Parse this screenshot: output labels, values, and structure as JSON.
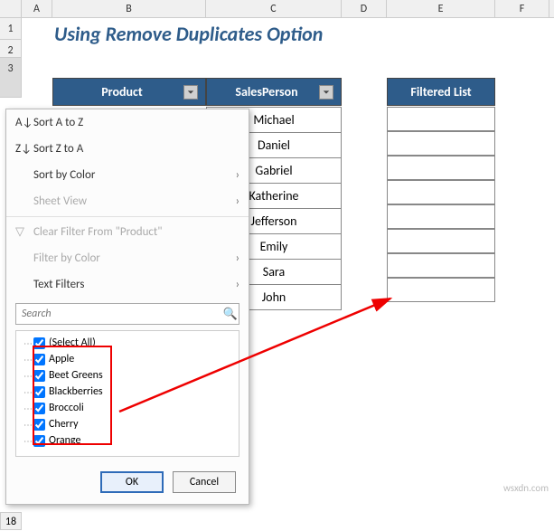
{
  "title": "Using Remove Duplicates Option",
  "columns": {
    "A": "A",
    "B": "B",
    "C": "C",
    "D": "D",
    "E": "E",
    "F": "F"
  },
  "rows": [
    "1",
    "2",
    "3",
    "18"
  ],
  "headers": {
    "product": "Product",
    "salesperson": "SalesPerson",
    "filtered": "Filtered List"
  },
  "salespersons": [
    "Michael",
    "Daniel",
    "Gabriel",
    "Katherine",
    "Jefferson",
    "Emily",
    "Sara",
    "John"
  ],
  "menu": {
    "sort_az": "Sort A to Z",
    "sort_za": "Sort Z to A",
    "sort_color": "Sort by Color",
    "sheet_view": "Sheet View",
    "clear_filter": "Clear Filter From \"Product\"",
    "filter_color": "Filter by Color",
    "text_filters": "Text Filters",
    "search_placeholder": "Search",
    "select_all": "(Select All)",
    "items": [
      "Apple",
      "Beet Greens",
      "Blackberries",
      "Broccoli",
      "Cherry",
      "Orange"
    ],
    "ok": "OK",
    "cancel": "Cancel"
  },
  "watermark": "wsxdn.com"
}
